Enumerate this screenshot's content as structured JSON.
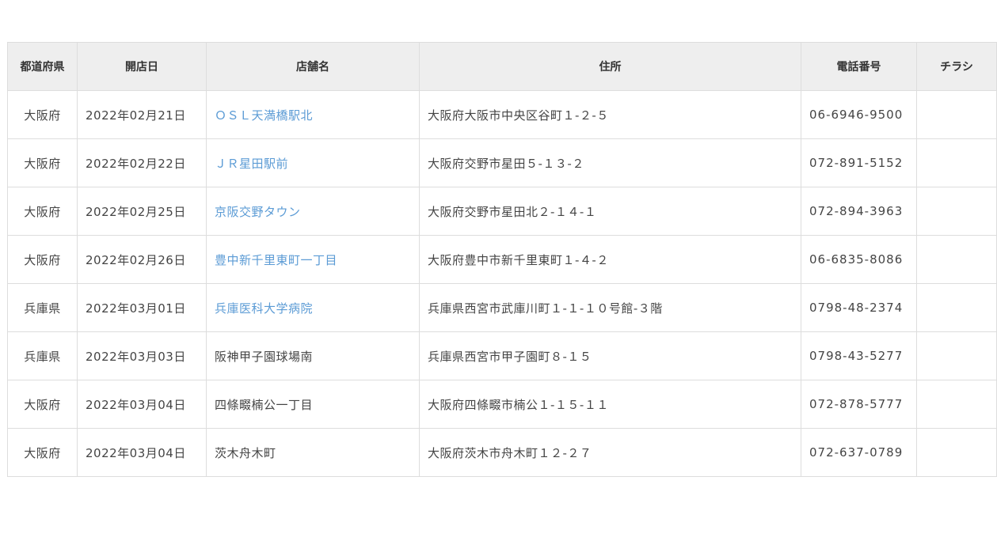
{
  "table": {
    "headers": [
      "都道府県",
      "開店日",
      "店舗名",
      "住所",
      "電話番号",
      "チラシ"
    ],
    "rows": [
      {
        "pref": "大阪府",
        "date": "2022年02月21日",
        "name": "ＯＳＬ天満橋駅北",
        "link": true,
        "address": "大阪府大阪市中央区谷町１-２-５",
        "tel": "06-6946-9500",
        "flyer": ""
      },
      {
        "pref": "大阪府",
        "date": "2022年02月22日",
        "name": "ＪＲ星田駅前",
        "link": true,
        "address": "大阪府交野市星田５-１３-２",
        "tel": "072-891-5152",
        "flyer": ""
      },
      {
        "pref": "大阪府",
        "date": "2022年02月25日",
        "name": "京阪交野タウン",
        "link": true,
        "address": "大阪府交野市星田北２-１４-１",
        "tel": "072-894-3963",
        "flyer": ""
      },
      {
        "pref": "大阪府",
        "date": "2022年02月26日",
        "name": "豊中新千里東町一丁目",
        "link": true,
        "address": "大阪府豊中市新千里東町１-４-２",
        "tel": "06-6835-8086",
        "flyer": ""
      },
      {
        "pref": "兵庫県",
        "date": "2022年03月01日",
        "name": "兵庫医科大学病院",
        "link": true,
        "address": "兵庫県西宮市武庫川町１-１-１０号館-３階",
        "tel": "0798-48-2374",
        "flyer": ""
      },
      {
        "pref": "兵庫県",
        "date": "2022年03月03日",
        "name": "阪神甲子園球場南",
        "link": false,
        "address": "兵庫県西宮市甲子園町８-１５",
        "tel": "0798-43-5277",
        "flyer": ""
      },
      {
        "pref": "大阪府",
        "date": "2022年03月04日",
        "name": "四條畷楠公一丁目",
        "link": false,
        "address": "大阪府四條畷市楠公１-１５-１１",
        "tel": "072-878-5777",
        "flyer": ""
      },
      {
        "pref": "大阪府",
        "date": "2022年03月04日",
        "name": "茨木舟木町",
        "link": false,
        "address": "大阪府茨木市舟木町１２-２７",
        "tel": "072-637-0789",
        "flyer": ""
      }
    ]
  },
  "colors": {
    "link": "#5b9bd5",
    "header_bg": "#eeeeee",
    "border": "#dddddd"
  }
}
